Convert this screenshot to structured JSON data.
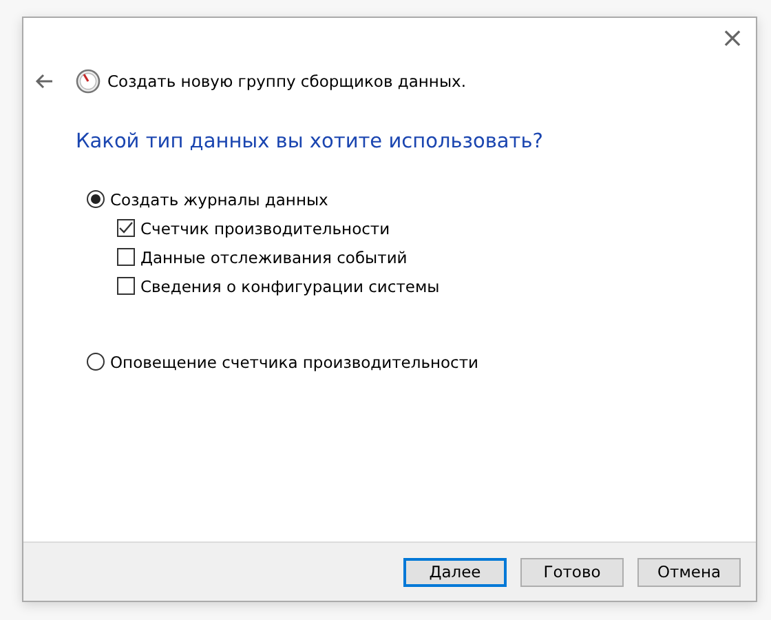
{
  "window": {
    "close": "×",
    "title": "Создать новую группу сборщиков данных."
  },
  "heading": "Какой тип данных вы хотите использовать?",
  "options": [
    {
      "label": "Создать журналы данных",
      "selected": true,
      "children": [
        {
          "label": "Счетчик производительности",
          "checked": true
        },
        {
          "label": "Данные отслеживания событий",
          "checked": false
        },
        {
          "label": "Сведения о конфигурации системы",
          "checked": false
        }
      ]
    },
    {
      "label": "Оповещение счетчика производительности",
      "selected": false
    }
  ],
  "buttons": [
    {
      "label": "Далее",
      "focused": true
    },
    {
      "label": "Готово",
      "focused": false
    },
    {
      "label": "Отмена",
      "focused": false
    }
  ]
}
